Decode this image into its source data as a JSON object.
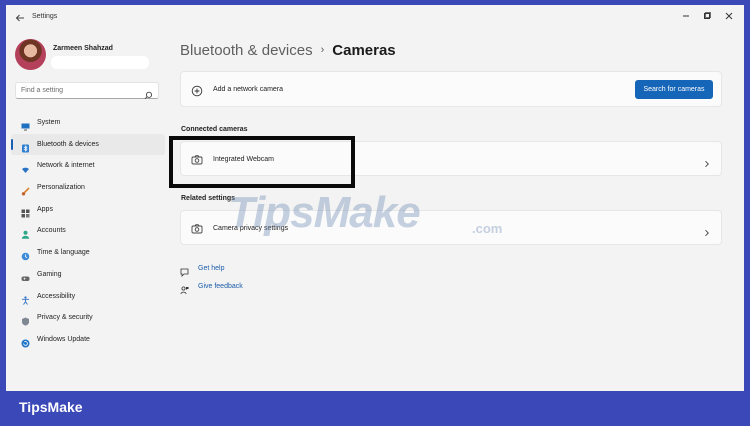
{
  "titlebar": {
    "app_title": "Settings"
  },
  "user": {
    "name": "Zarmeen Shahzad"
  },
  "search": {
    "placeholder": "Find a setting"
  },
  "nav": {
    "items": [
      {
        "label": "System",
        "icon": "monitor-icon",
        "selected": false
      },
      {
        "label": "Bluetooth & devices",
        "icon": "bluetooth-icon",
        "selected": true
      },
      {
        "label": "Network & internet",
        "icon": "wifi-icon",
        "selected": false
      },
      {
        "label": "Personalization",
        "icon": "brush-icon",
        "selected": false
      },
      {
        "label": "Apps",
        "icon": "apps-icon",
        "selected": false
      },
      {
        "label": "Accounts",
        "icon": "person-icon",
        "selected": false
      },
      {
        "label": "Time & language",
        "icon": "globe-clock-icon",
        "selected": false
      },
      {
        "label": "Gaming",
        "icon": "gamepad-icon",
        "selected": false
      },
      {
        "label": "Accessibility",
        "icon": "accessibility-icon",
        "selected": false
      },
      {
        "label": "Privacy & security",
        "icon": "shield-icon",
        "selected": false
      },
      {
        "label": "Windows Update",
        "icon": "update-icon",
        "selected": false
      }
    ]
  },
  "breadcrumb": {
    "parent": "Bluetooth & devices",
    "separator": "›",
    "current": "Cameras"
  },
  "add_camera": {
    "label": "Add a network camera",
    "button": "Search for cameras"
  },
  "connected": {
    "heading": "Connected cameras",
    "cameras": [
      {
        "label": "Integrated Webcam"
      }
    ]
  },
  "related": {
    "heading": "Related settings",
    "items": [
      {
        "label": "Camera privacy settings"
      }
    ]
  },
  "help": {
    "get_help": "Get help",
    "feedback": "Give feedback"
  },
  "watermark": {
    "text": "TipsMake",
    "suffix": ".com"
  },
  "footer": {
    "brand": "TipsMake"
  },
  "colors": {
    "accent": "#1565b8",
    "frame": "#3b48b7",
    "highlight": "#0a0a0a"
  }
}
